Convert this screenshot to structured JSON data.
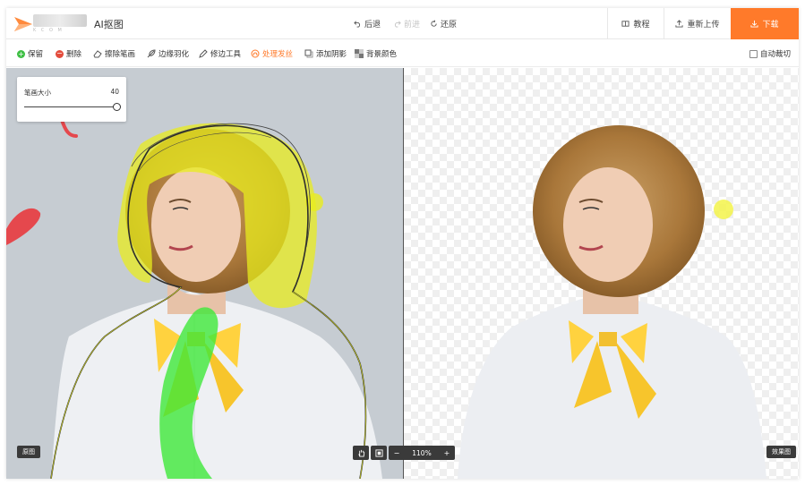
{
  "header": {
    "app_title": "AI抠图",
    "logo_sub": "K          C O M",
    "history": {
      "undo": "后退",
      "redo": "前进",
      "restore": "还原"
    },
    "tutorial": "教程",
    "reupload": "重新上传",
    "download": "下载"
  },
  "toolbar": {
    "keep": "保留",
    "delete": "删除",
    "erase": "擦除笔画",
    "feather": "边缘羽化",
    "edge_tool": "修边工具",
    "hair": "处理发丝",
    "shadow": "添加阴影",
    "bg_color": "背景颜色",
    "auto_crop": "自动裁切"
  },
  "brush": {
    "label": "笔画大小",
    "value": "40",
    "level": 1.0
  },
  "canvas": {
    "left_tag": "原图",
    "right_tag": "效果图",
    "zoom": "110%"
  },
  "colors": {
    "accent": "#ff7a2a",
    "keep_brush": "#3fe83a",
    "hair_brush": "#e8ec1e",
    "delete_brush": "#e5484d"
  }
}
